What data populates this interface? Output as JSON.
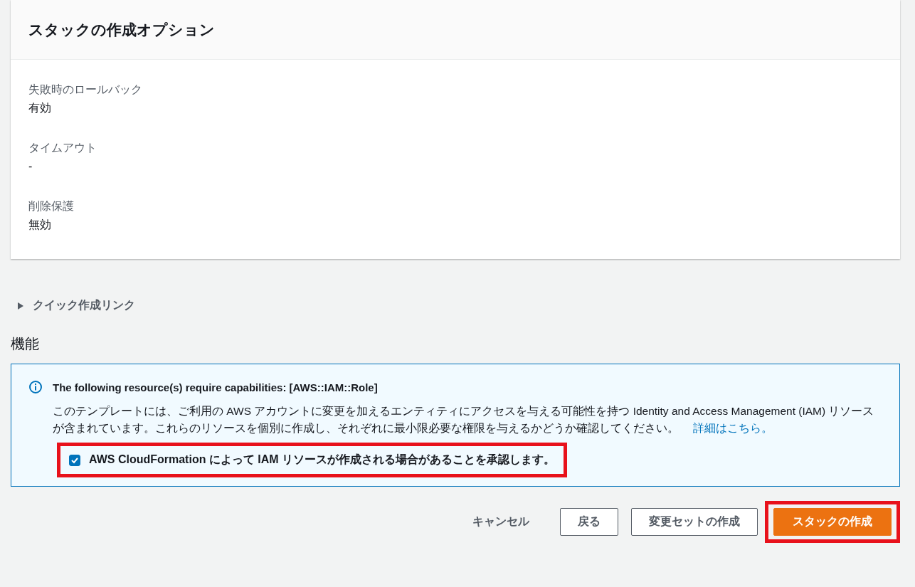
{
  "options_card": {
    "title": "スタックの作成オプション",
    "fields": [
      {
        "label": "失敗時のロールバック",
        "value": "有効"
      },
      {
        "label": "タイムアウト",
        "value": "-"
      },
      {
        "label": "削除保護",
        "value": "無効"
      }
    ]
  },
  "quick_create": {
    "label": "クイック作成リンク",
    "expanded": false
  },
  "capabilities": {
    "heading": "機能",
    "alert": {
      "title": "The following resource(s) require capabilities: [AWS::IAM::Role]",
      "text": "このテンプレートには、ご利用の AWS アカウントに変更を加えるエンティティにアクセスを与える可能性を持つ Identity and Access Management (IAM) リソースが含まれています。これらのリソースを個別に作成し、それぞれに最小限必要な権限を与えるかどうか確認してください。",
      "link": "詳細はこちら。"
    },
    "acknowledge": {
      "label": "AWS CloudFormation によって IAM リソースが作成される場合があることを承認します。",
      "checked": true,
      "highlighted": true
    }
  },
  "buttons": [
    {
      "label": "キャンセル",
      "kind": "link",
      "highlighted": false
    },
    {
      "label": "戻る",
      "kind": "normal",
      "highlighted": false
    },
    {
      "label": "変更セットの作成",
      "kind": "normal",
      "highlighted": false
    },
    {
      "label": "スタックの作成",
      "kind": "primary",
      "highlighted": true
    }
  ]
}
